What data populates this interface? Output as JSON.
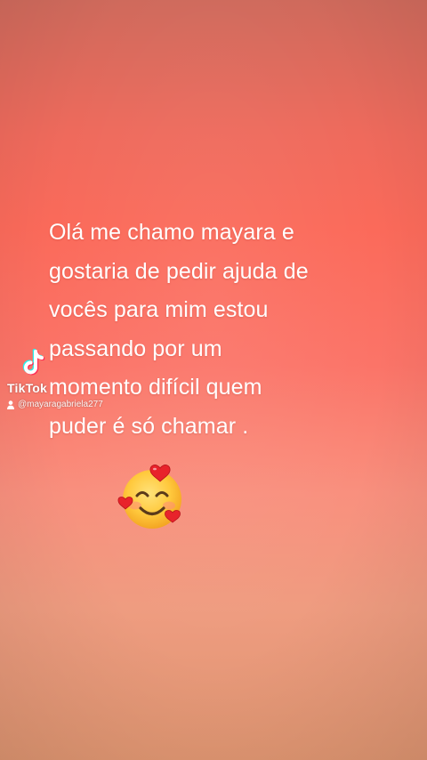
{
  "message": {
    "lines": [
      "Olá me chamo mayara e",
      "gostaria de pedir ajuda de",
      "vocês para mim estou",
      "passando por um",
      "momento difícil quem",
      "puder é só chamar ."
    ]
  },
  "emoji": {
    "icon": "smiling-face-with-hearts-icon"
  },
  "watermark": {
    "brand": "TikTok",
    "handle": "@mayaragabriela277",
    "logo_icon": "tiktok-logo-icon",
    "user_icon": "user-icon"
  },
  "colors": {
    "background_top": "#cf6a5c",
    "background_mid": "#fb6a5a",
    "background_bottom": "#dd9470",
    "text": "#ffffff",
    "heart": "#e8232b",
    "emoji_face": "#ffc23a"
  }
}
